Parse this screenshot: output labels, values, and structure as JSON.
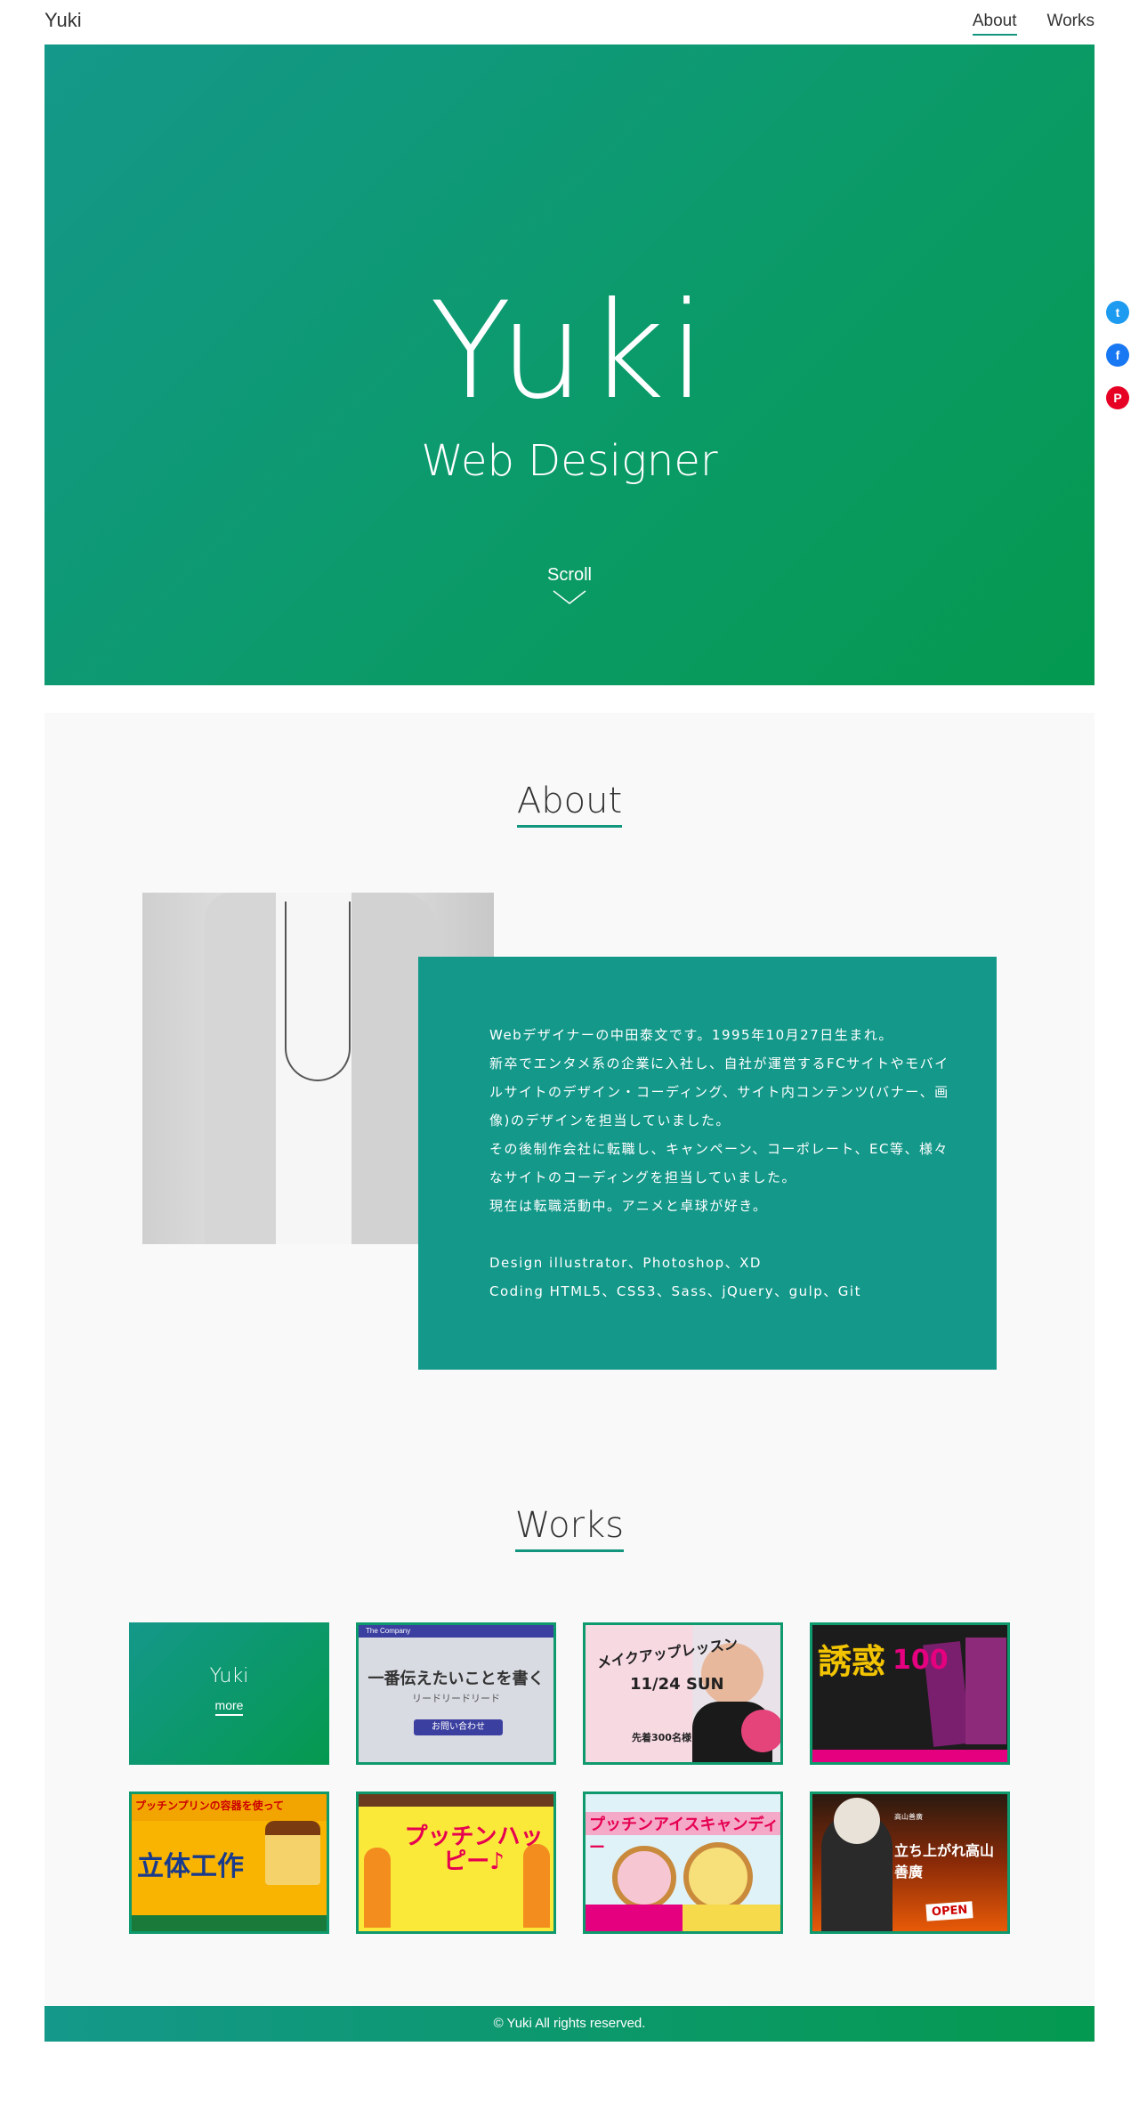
{
  "header": {
    "logo": "Yuki",
    "nav": [
      {
        "label": "About",
        "active": true
      },
      {
        "label": "Works",
        "active": false
      }
    ]
  },
  "hero": {
    "title": "Yuki",
    "subtitle": "Web Designer",
    "scroll_label": "Scroll"
  },
  "share": {
    "icons": [
      "twitter-icon",
      "facebook-icon",
      "pinterest-icon"
    ]
  },
  "about": {
    "heading": "About",
    "paragraphs": [
      "Webデザイナーの中田泰文です。1995年10月27日生まれ。",
      "新卒でエンタメ系の企業に入社し、自社が運営するFCサイトやモバイルサイトのデザイン・コーディング、サイト内コンテンツ(バナー、画像)のデザインを担当していました。",
      "その後制作会社に転職し、キャンペーン、コーポレート、EC等、様々なサイトのコーディングを担当していました。",
      "現在は転職活動中。アニメと卓球が好き。"
    ],
    "skills": [
      "Design illustrator、Photoshop、XD",
      "Coding HTML5、CSS3、Sass、jQuery、gulp、Git"
    ]
  },
  "works": {
    "heading": "Works",
    "intro_card": {
      "title": "Yuki",
      "more": "more"
    },
    "items": [
      {
        "head": "The Company",
        "heading": "一番伝えたいことを書く",
        "sub": "リードリードリード",
        "button": "お問い合わせ"
      },
      {
        "heading": "メイクアップレッスン",
        "date": "11/24 SUN",
        "price": "先着300名様"
      },
      {
        "heading": "誘惑",
        "number": "100"
      },
      {
        "top": "プッチンプリンの容器を使って",
        "heading": "立体工作"
      },
      {
        "heading": "プッチンハッピー♪"
      },
      {
        "heading": "プッチンアイスキャンディー"
      },
      {
        "top": "高山善廣",
        "heading": "立ち上がれ高山善廣",
        "tag": "OPEN"
      }
    ]
  },
  "footer": {
    "copyright": "© Yuki All rights reserved."
  },
  "colors": {
    "accent": "#12967e",
    "gradient_start": "#14988a",
    "gradient_end": "#04994f",
    "section_bg": "#f9f9f9"
  }
}
